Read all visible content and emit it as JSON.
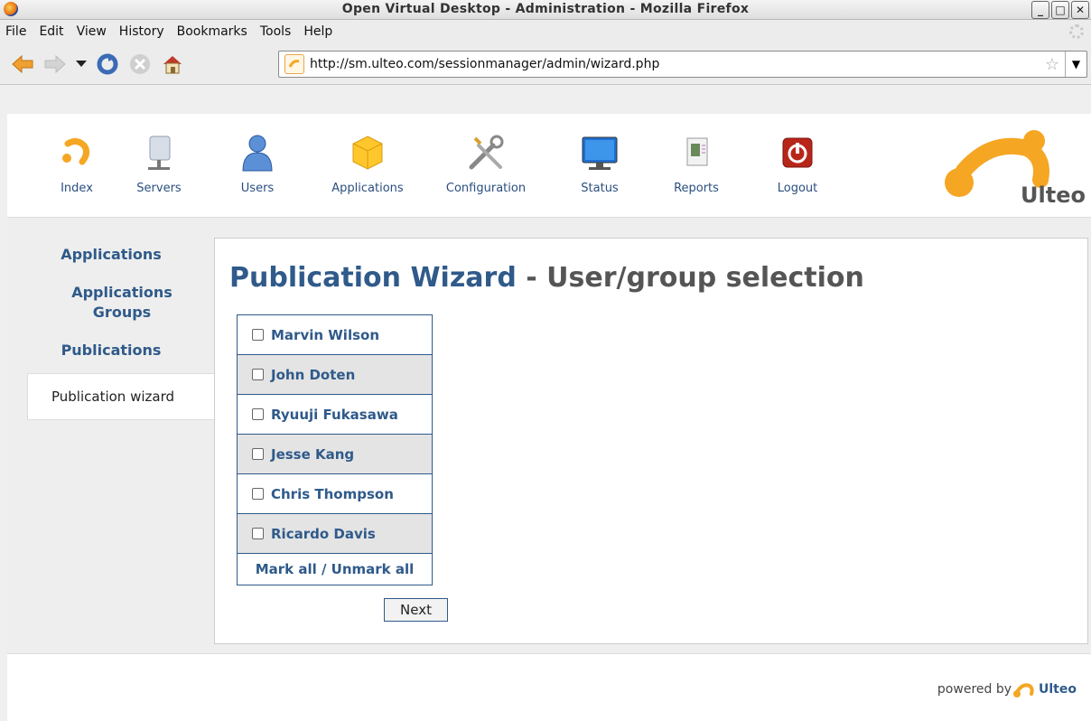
{
  "window": {
    "title": "Open Virtual Desktop - Administration - Mozilla Firefox"
  },
  "menu": [
    "File",
    "Edit",
    "View",
    "History",
    "Bookmarks",
    "Tools",
    "Help"
  ],
  "urlbar": {
    "url": "http://sm.ulteo.com/sessionmanager/admin/wizard.php"
  },
  "nav": {
    "items": [
      {
        "label": "Index"
      },
      {
        "label": "Servers"
      },
      {
        "label": "Users"
      },
      {
        "label": "Applications"
      },
      {
        "label": "Configuration"
      },
      {
        "label": "Status"
      },
      {
        "label": "Reports"
      },
      {
        "label": "Logout"
      }
    ],
    "logo_text": "Ulteo"
  },
  "sidebar": {
    "items": [
      {
        "label": "Applications"
      },
      {
        "label": "Applications Groups"
      },
      {
        "label": "Publications"
      },
      {
        "label": "Publication wizard"
      }
    ]
  },
  "main": {
    "title": "Publication Wizard",
    "subtitle": " - User/group selection",
    "users": [
      "Marvin Wilson",
      "John Doten",
      "Ryuuji Fukasawa",
      "Jesse Kang",
      "Chris Thompson",
      "Ricardo Davis"
    ],
    "mark_all": "Mark all / Unmark all",
    "next_label": "Next"
  },
  "footer": {
    "powered_by": "powered by",
    "brand": "Ulteo"
  },
  "colors": {
    "accent": "#2f5a8a",
    "logo_orange": "#f5a623"
  }
}
